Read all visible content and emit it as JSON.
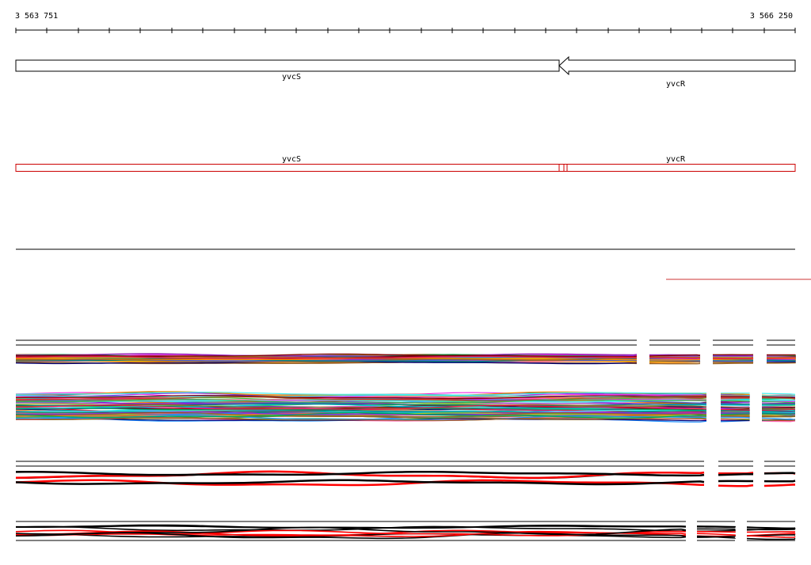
{
  "ruler": {
    "start_label": "3 563 751",
    "end_label": "3 566 250"
  },
  "genes": [
    {
      "name": "yvcS",
      "strand": "-",
      "color": "#000000"
    },
    {
      "name": "yvcR",
      "strand": "-",
      "color": "#000000"
    }
  ],
  "predicted_genes": [
    {
      "name": "yvcS",
      "color": "#cc0000"
    },
    {
      "name": "yvcR",
      "color": "#cc0000"
    }
  ],
  "colors": {
    "annotation": "#000000",
    "prediction": "#cc0000",
    "highlight": "#ff0000"
  }
}
